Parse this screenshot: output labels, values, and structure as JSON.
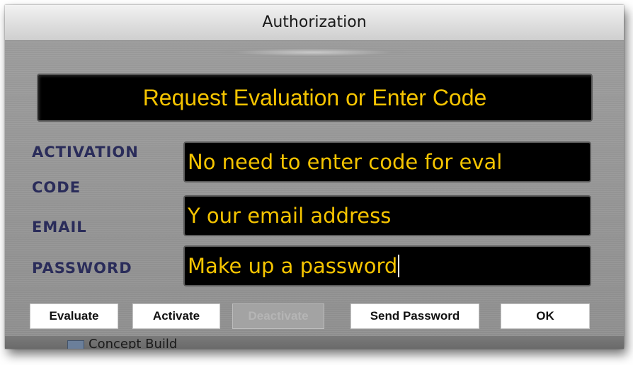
{
  "window": {
    "title": "Authorization"
  },
  "banner": {
    "text": "Request Evaluation or Enter Code"
  },
  "fields": {
    "activation": {
      "label_line1": "ACTIVATION",
      "label_line2": "CODE",
      "value": "No need to enter code for eval"
    },
    "email": {
      "label": "EMAIL",
      "value": "Y our email address"
    },
    "password": {
      "label": "PASSWORD",
      "value": "Make up a password"
    }
  },
  "buttons": {
    "evaluate": "Evaluate",
    "activate": "Activate",
    "deactivate": "Deactivate",
    "send_password": "Send  Password",
    "ok": "OK"
  },
  "background": {
    "partial_text": "Concept Build"
  },
  "colors": {
    "accent_text": "#f5c400",
    "label_text": "#2a2c5a",
    "field_bg": "#000000"
  }
}
